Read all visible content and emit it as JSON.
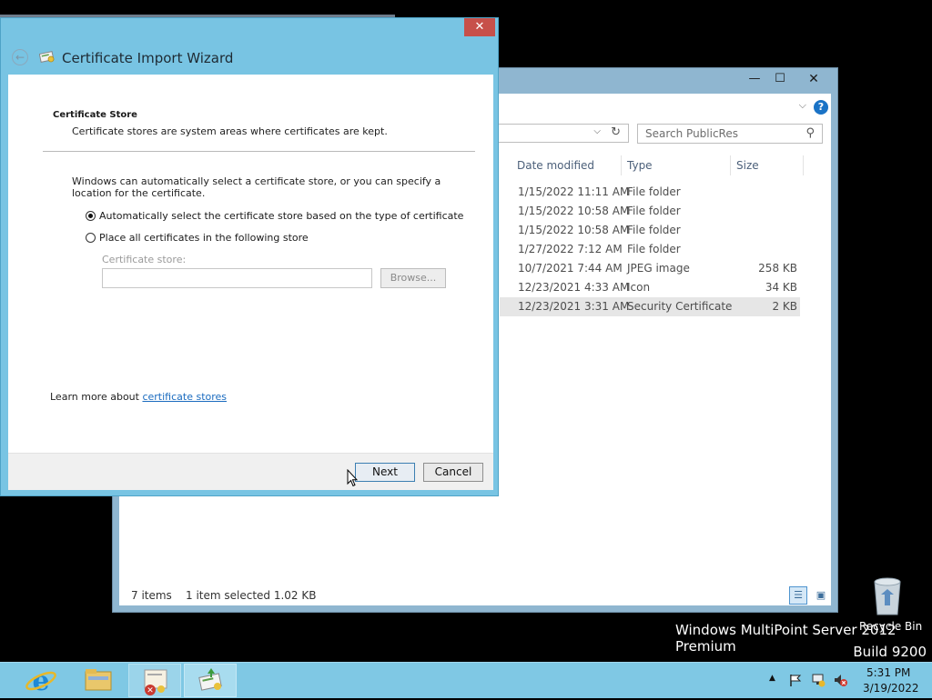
{
  "wizard": {
    "title": "Certificate Import Wizard",
    "close_glyph": "✕",
    "back_glyph": "←",
    "section_title": "Certificate Store",
    "section_desc": "Certificate stores are system areas where certificates are kept.",
    "intro": "Windows can automatically select a certificate store, or you can specify a location for the certificate.",
    "option_auto": "Automatically select the certificate store based on the type of certificate",
    "option_manual": "Place all certificates in the following store",
    "store_label": "Certificate store:",
    "store_value": "",
    "browse_label": "Browse...",
    "learn_prefix": "Learn more about ",
    "learn_link": "certificate stores",
    "next_label": "Next",
    "cancel_label": "Cancel",
    "selected_option": "auto"
  },
  "explorer": {
    "minimize_glyph": "—",
    "maximize_glyph": "☐",
    "close_glyph": "✕",
    "help_glyph": "?",
    "search_placeholder": "Search PublicRes",
    "columns": {
      "date": "Date modified",
      "type": "Type",
      "size": "Size"
    },
    "rows": [
      {
        "date": "1/15/2022 11:11 AM",
        "type": "File folder",
        "size": ""
      },
      {
        "date": "1/15/2022 10:58 AM",
        "type": "File folder",
        "size": ""
      },
      {
        "date": "1/15/2022 10:58 AM",
        "type": "File folder",
        "size": ""
      },
      {
        "date": "1/27/2022 7:12 AM",
        "type": "File folder",
        "size": ""
      },
      {
        "date": "10/7/2021 7:44 AM",
        "type": "JPEG image",
        "size": "258 KB"
      },
      {
        "date": "12/23/2021 4:33 AM",
        "type": "Icon",
        "size": "34 KB"
      },
      {
        "date": "12/23/2021 3:31 AM",
        "type": "Security Certificate",
        "size": "2 KB"
      }
    ],
    "selected_row": 6,
    "status_items": "7 items",
    "status_selected": "1 item selected  1.02 KB"
  },
  "desktop": {
    "recycle_label": "Recycle Bin",
    "brand": "Windows MultiPoint Server 2012 Premium",
    "build": "Build 9200"
  },
  "taskbar": {
    "time": "5:31 PM",
    "date": "3/19/2022",
    "tray_up_glyph": "▲"
  },
  "colors": {
    "window_frame": "#78c4e3",
    "taskbar": "#7fc8e4",
    "close_red": "#c7504a",
    "link": "#1a6bbf"
  }
}
